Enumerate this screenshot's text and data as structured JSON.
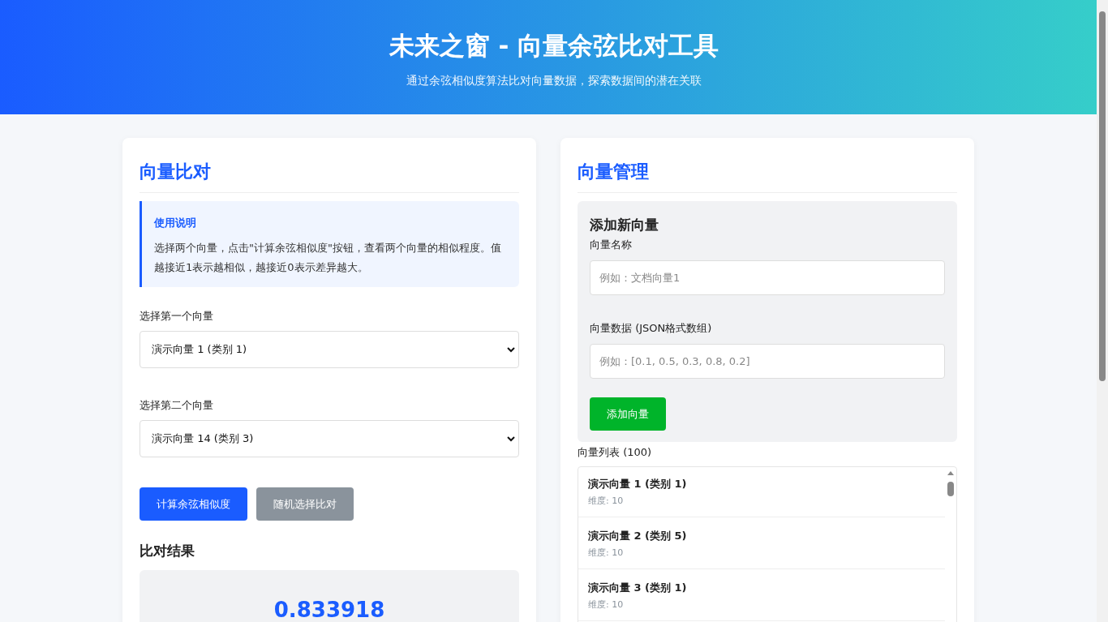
{
  "header": {
    "title": "未来之窗 - 向量余弦比对工具",
    "subtitle": "通过余弦相似度算法比对向量数据，探索数据间的潜在关联"
  },
  "compare": {
    "title": "向量比对",
    "info": {
      "title": "使用说明",
      "text": "选择两个向量，点击\"计算余弦相似度\"按钮，查看两个向量的相似程度。值越接近1表示越相似，越接近0表示差异越大。"
    },
    "selects": [
      {
        "label": "选择第一个向量",
        "value": "演示向量 1 (类别 1)"
      },
      {
        "label": "选择第二个向量",
        "value": "演示向量 14 (类别 3)"
      }
    ],
    "buttons": [
      {
        "label": "计算余弦相似度",
        "kind": "primary"
      },
      {
        "label": "随机选择比对",
        "kind": "secondary"
      }
    ],
    "result": {
      "title": "比对结果",
      "value": "0.833918"
    }
  },
  "manage": {
    "title": "向量管理",
    "form": {
      "title": "添加新向量",
      "fields": [
        {
          "label": "向量名称",
          "placeholder": "例如：文档向量1"
        },
        {
          "label": "向量数据 (JSON格式数组)",
          "placeholder": "例如：[0.1, 0.5, 0.3, 0.8, 0.2]"
        }
      ],
      "button": "添加向量"
    },
    "list": {
      "title": "向量列表 (100)",
      "items": [
        {
          "name": "演示向量 1 (类别 1)",
          "meta": "维度: 10"
        },
        {
          "name": "演示向量 2 (类别 5)",
          "meta": "维度: 10"
        },
        {
          "name": "演示向量 3 (类别 1)",
          "meta": "维度: 10"
        }
      ]
    }
  }
}
